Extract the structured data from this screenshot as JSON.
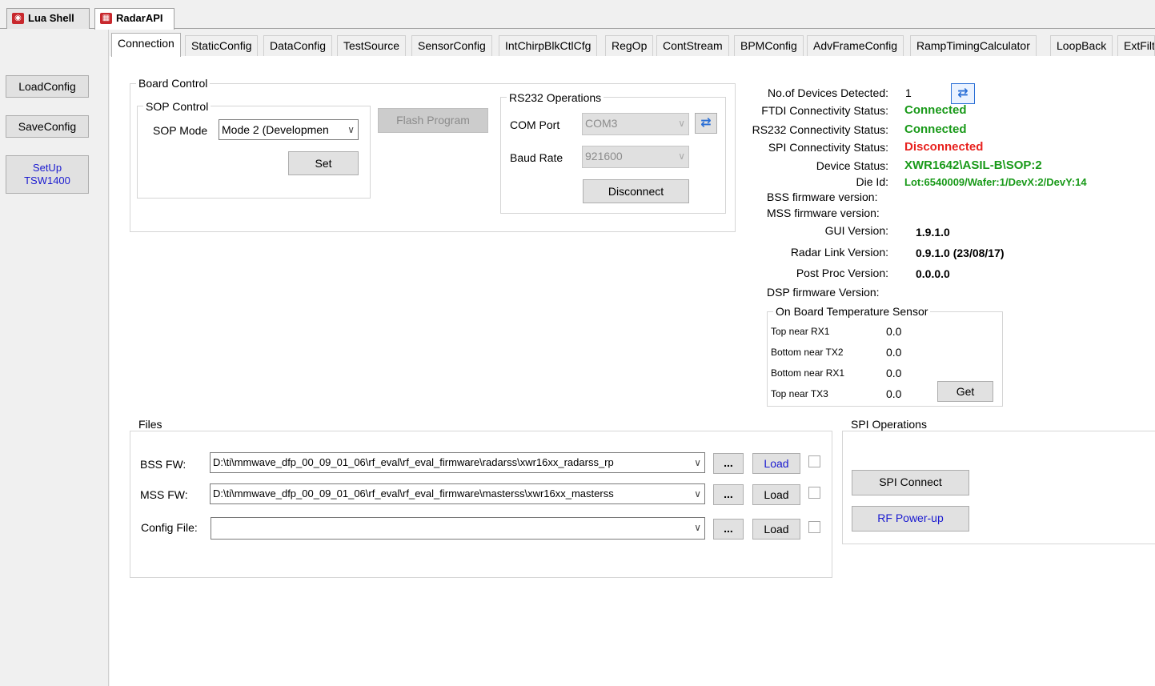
{
  "window_tabs": [
    {
      "label": "Lua Shell"
    },
    {
      "label": "RadarAPI"
    }
  ],
  "sidebar": {
    "load_config": "LoadConfig",
    "save_config": "SaveConfig",
    "setup_line1": "SetUp",
    "setup_line2": "TSW1400"
  },
  "tabs": [
    {
      "label": "Connection"
    },
    {
      "label": "StaticConfig"
    },
    {
      "label": "DataConfig"
    },
    {
      "label": "TestSource"
    },
    {
      "label": "SensorConfig"
    },
    {
      "label": "IntChirpBlkCtlCfg"
    },
    {
      "label": "RegOp"
    },
    {
      "label": "ContStream"
    },
    {
      "label": "BPMConfig"
    },
    {
      "label": "AdvFrameConfig"
    },
    {
      "label": "RampTimingCalculator"
    },
    {
      "label": "LoopBack"
    },
    {
      "label": "ExtFilt"
    }
  ],
  "board_control": {
    "title": "Board Control",
    "sop_title": "SOP Control",
    "sop_mode_label": "SOP Mode",
    "sop_mode_value": "Mode 2 (Developmen",
    "set_button": "Set",
    "flash_button": "Flash Program"
  },
  "rs232": {
    "title": "RS232 Operations",
    "com_label": "COM Port",
    "com_value": "COM3",
    "baud_label": "Baud Rate",
    "baud_value": "921600",
    "disconnect_button": "Disconnect"
  },
  "status": {
    "devices_label": "No.of Devices Detected:",
    "devices_value": "1",
    "ftdi_label": "FTDI Connectivity Status:",
    "ftdi_value": "Connected",
    "rs232_label": "RS232 Connectivity Status:",
    "rs232_value": "Connected",
    "spi_label": "SPI Connectivity Status:",
    "spi_value": "Disconnected",
    "device_status_label": "Device Status:",
    "device_status_value": "XWR1642\\ASIL-B\\SOP:2",
    "die_id_label": "Die Id:",
    "die_id_value": "Lot:6540009/Wafer:1/DevX:2/DevY:14",
    "bss_fw_label": "BSS firmware version:",
    "mss_fw_label": "MSS firmware version:",
    "gui_label": "GUI Version:",
    "gui_value": "1.9.1.0",
    "radar_link_label": "Radar Link Version:",
    "radar_link_value": "0.9.1.0 (23/08/17)",
    "post_proc_label": "Post Proc Version:",
    "post_proc_value": "0.0.0.0",
    "dsp_fw_label": "DSP firmware Version:"
  },
  "temperature": {
    "title": "On Board Temperature Sensor",
    "rows": [
      {
        "label": "Top near RX1",
        "value": "0.0"
      },
      {
        "label": "Bottom near TX2",
        "value": "0.0"
      },
      {
        "label": "Bottom near RX1",
        "value": "0.0"
      },
      {
        "label": "Top near TX3",
        "value": "0.0"
      }
    ],
    "get_button": "Get"
  },
  "files": {
    "title": "Files",
    "bss_label": "BSS FW:",
    "bss_value": "D:\\ti\\mmwave_dfp_00_09_01_06\\rf_eval\\rf_eval_firmware\\radarss\\xwr16xx_radarss_rp",
    "mss_label": "MSS FW:",
    "mss_value": "D:\\ti\\mmwave_dfp_00_09_01_06\\rf_eval\\rf_eval_firmware\\masterss\\xwr16xx_masterss",
    "config_label": "Config File:",
    "config_value": "",
    "browse_label": "...",
    "load_label": "Load"
  },
  "spi": {
    "title": "SPI Operations",
    "connect_button": "SPI Connect",
    "rf_power_button": "RF Power-up"
  }
}
